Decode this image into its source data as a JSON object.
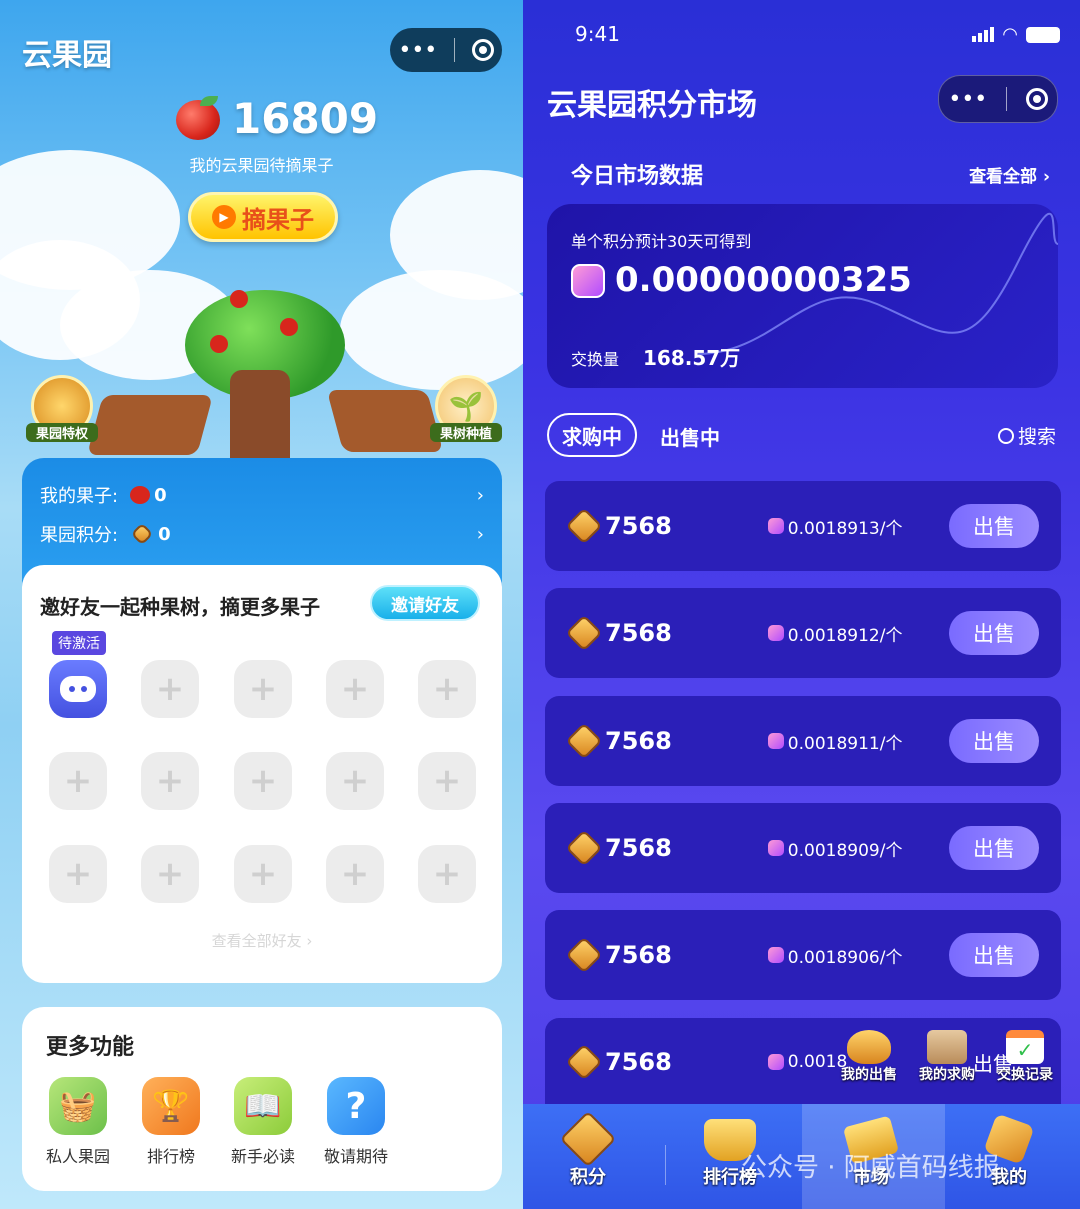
{
  "left": {
    "app_title": "云果园",
    "fruit_count": "16809",
    "fruit_subtitle": "我的云果园待摘果子",
    "pick_button": "摘果子",
    "orchard_privilege": "果园特权",
    "tree_planting": "果树种植",
    "my_fruit_label": "我的果子:",
    "my_fruit_value": "0",
    "orchard_points_label": "果园积分:",
    "orchard_points_value": "0",
    "invite_title": "邀好友一起种果树，摘更多果子",
    "invite_button": "邀请好友",
    "pending_badge": "待激活",
    "view_all_friends": "查看全部好友",
    "more_features_title": "更多功能",
    "features": [
      {
        "label": "私人果园",
        "icon": "orchard-icon"
      },
      {
        "label": "排行榜",
        "icon": "trophy-icon"
      },
      {
        "label": "新手必读",
        "icon": "book-icon"
      },
      {
        "label": "敬请期待",
        "icon": "question-icon"
      }
    ]
  },
  "right": {
    "status_time": "9:41",
    "page_title": "云果园积分市场",
    "market_data_title": "今日市场数据",
    "view_all": "查看全部",
    "card_subtitle": "单个积分预计30天可得到",
    "card_value": "0.00000000325",
    "exchange_label": "交换量",
    "exchange_value": "168.57万",
    "tab_buying": "求购中",
    "tab_selling": "出售中",
    "search": "搜索",
    "sell_button": "出售",
    "rows": [
      {
        "amount": "7568",
        "price": "0.0018913/个"
      },
      {
        "amount": "7568",
        "price": "0.0018912/个"
      },
      {
        "amount": "7568",
        "price": "0.0018911/个"
      },
      {
        "amount": "7568",
        "price": "0.0018909/个"
      },
      {
        "amount": "7568",
        "price": "0.0018906/个"
      },
      {
        "amount": "7568",
        "price": "0.0018"
      }
    ],
    "floating_actions": [
      "我的出售",
      "我的求购",
      "交换记录"
    ],
    "partial_sell": "出售",
    "bottom_tabs": [
      "积分",
      "排行榜",
      "市场",
      "我的"
    ],
    "watermark": "公众号 · 阿威首码线报"
  }
}
